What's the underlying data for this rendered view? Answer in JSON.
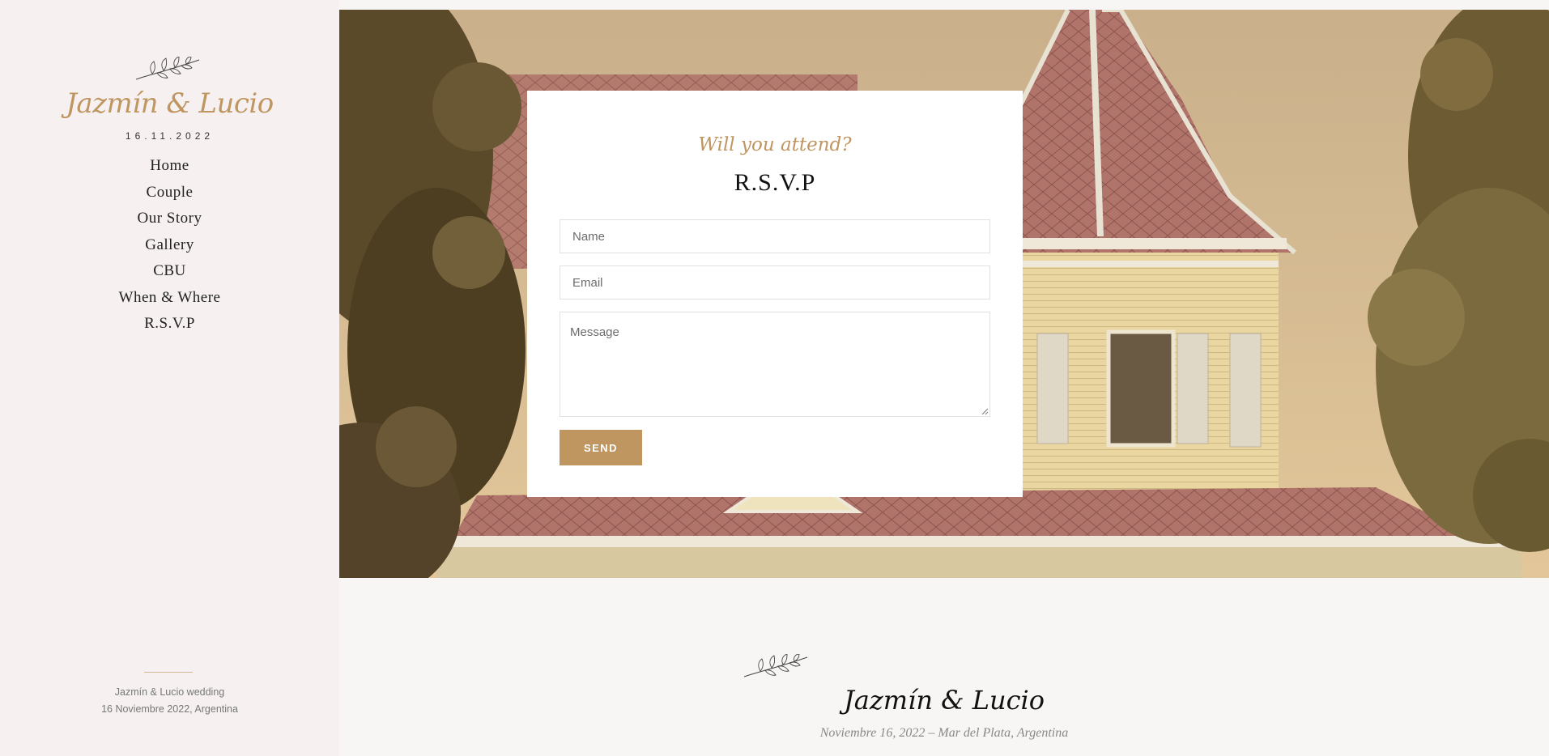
{
  "sidebar": {
    "brand": "Jazmín & Lucio",
    "date": "16.11.2022",
    "nav": [
      "Home",
      "Couple",
      "Our Story",
      "Gallery",
      "CBU",
      "When & Where",
      "R.S.V.P"
    ],
    "footer_line1": "Jazmín & Lucio wedding",
    "footer_line2": "16 Noviembre 2022, Argentina",
    "logo_icon": "olive-branch-icon"
  },
  "rsvp": {
    "kicker": "Will you attend?",
    "title": "R.S.V.P",
    "name_placeholder": "Name",
    "email_placeholder": "Email",
    "message_placeholder": "Message",
    "send_label": "SEND"
  },
  "footer": {
    "names": "Jazmín & Lucio",
    "subtitle": "Noviembre 16, 2022 – Mar del Plata, Argentina",
    "logo_icon": "olive-branch-icon"
  },
  "colors": {
    "accent": "#bf9560",
    "sidebar_bg": "#f6f1f0",
    "page_bg": "#f8f6f5"
  }
}
